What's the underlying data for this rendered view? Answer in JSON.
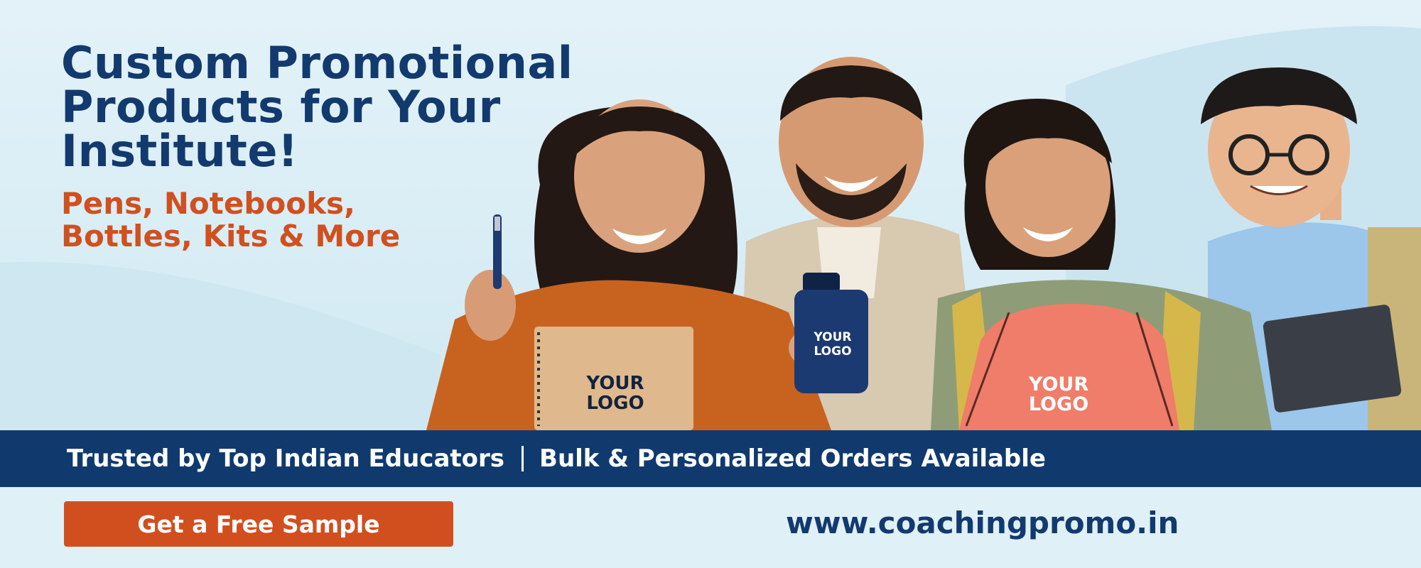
{
  "banner": {
    "headline": "Custom Promotional\nProducts for Your\nInstitute!",
    "subheadline": "Pens, Notebooks,\nBottles, Kits & More"
  },
  "products": {
    "notebook_logo_line1": "YOUR",
    "notebook_logo_line2": "LOGO",
    "bottle_logo_line1": "YOUR",
    "bottle_logo_line2": "LOGO",
    "bag_logo_line1": "YOUR",
    "bag_logo_line2": "LOGO"
  },
  "strip": {
    "left_text": "Trusted by Top Indian Educators",
    "right_text": "Bulk & Personalized Orders Available"
  },
  "cta": {
    "label": "Get a Free Sample"
  },
  "website": "www.coachingpromo.in",
  "colors": {
    "navy": "#123a6e",
    "orange": "#d0501f",
    "strip": "#103a6e",
    "background": "#e3f2f8"
  }
}
